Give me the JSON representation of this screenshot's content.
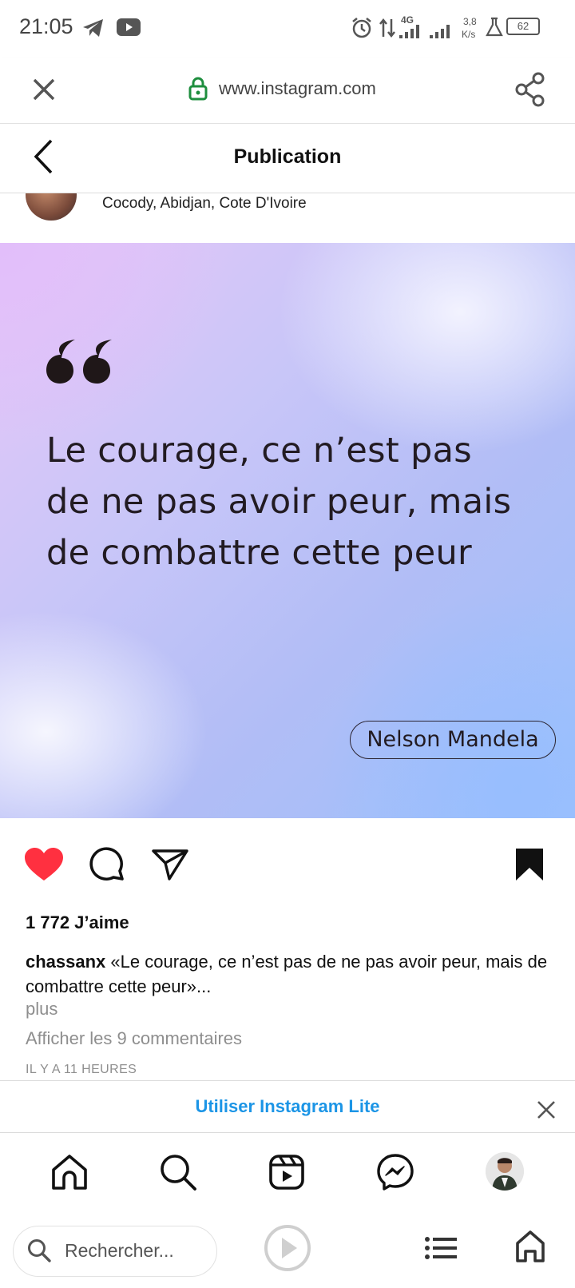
{
  "status_bar": {
    "time": "21:05",
    "network": "4G",
    "speed_value": "3,8",
    "speed_unit": "K/s",
    "battery": "62",
    "icons": [
      "telegram-icon",
      "youtube-icon",
      "alarm-icon",
      "data-arrows-icon",
      "signal-icon",
      "signal-icon",
      "flask-icon",
      "battery-icon"
    ]
  },
  "browser": {
    "url": "www.instagram.com",
    "close_icon": "close-icon",
    "lock_icon": "lock-icon",
    "share_icon": "share-icon"
  },
  "header": {
    "title": "Publication",
    "back_icon": "chevron-left-icon"
  },
  "post": {
    "location": "Cocody, Abidjan, Cote D'Ivoire",
    "quote": "Le courage, ce n’est pas de ne pas avoir peur, mais de combattre cette peur",
    "author": "Nelson Mandela",
    "liked": true,
    "likes": "1 772 J’aime",
    "username": "chassanx",
    "caption": "«Le courage, ce n’est pas de ne pas avoir peur, mais de combattre cette peur»...",
    "more": "plus",
    "comments_link": "Afficher les 9 commentaires",
    "time_ago": "IL Y A 11 HEURES"
  },
  "lite_banner": {
    "text": "Utiliser Instagram Lite"
  },
  "ig_nav": [
    "home-icon",
    "search-icon",
    "reels-icon",
    "messenger-icon",
    "profile-avatar"
  ],
  "browser_bottom": {
    "search_placeholder": "Rechercher...",
    "icons": [
      "search-icon",
      "play-icon",
      "list-icon",
      "home-icon"
    ]
  },
  "colors": {
    "like_red": "#ff3040",
    "lite_blue": "#1c95e6",
    "lock_green": "#1e8e3e"
  }
}
